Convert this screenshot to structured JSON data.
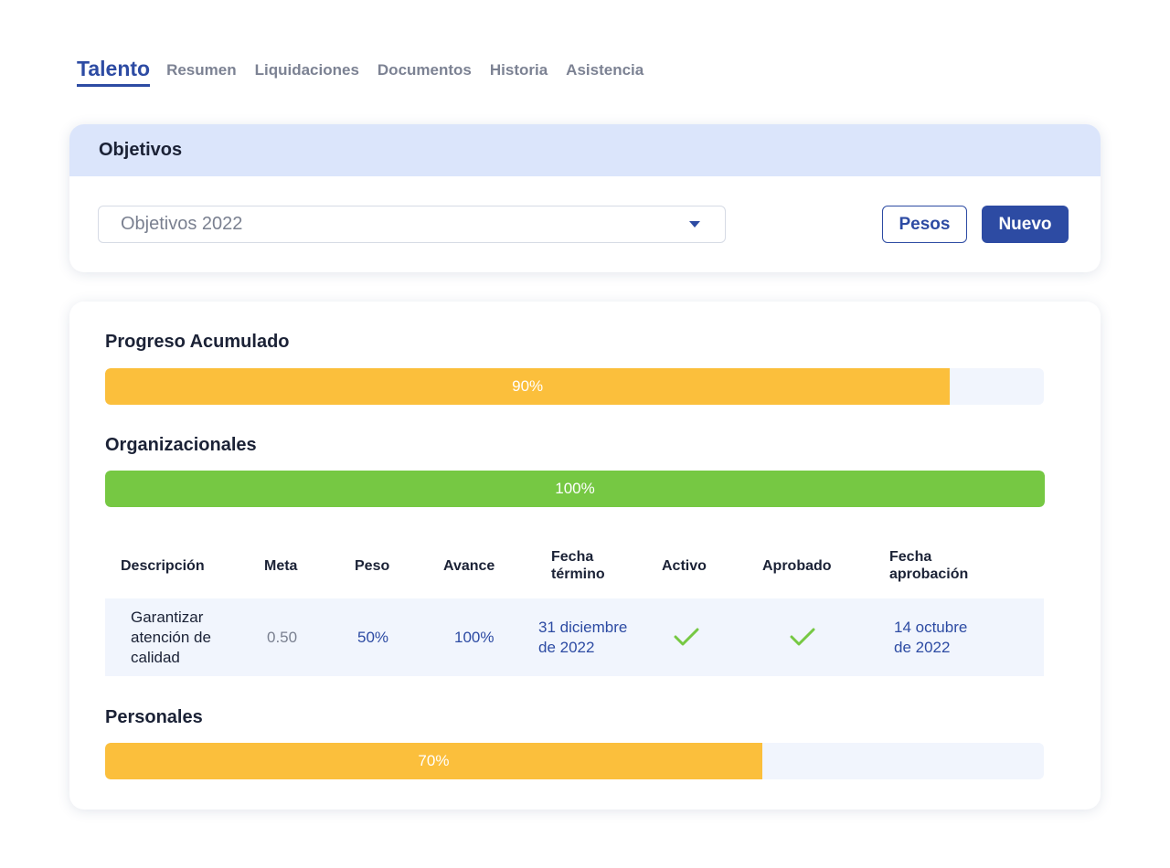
{
  "tabs": [
    {
      "label": "Talento",
      "active": true
    },
    {
      "label": "Resumen",
      "active": false
    },
    {
      "label": "Liquidaciones",
      "active": false
    },
    {
      "label": "Documentos",
      "active": false
    },
    {
      "label": "Historia",
      "active": false
    },
    {
      "label": "Asistencia",
      "active": false
    }
  ],
  "objetivos": {
    "title": "Objetivos",
    "select_value": "Objetivos 2022",
    "pesos_label": "Pesos",
    "nuevo_label": "Nuevo"
  },
  "progreso": {
    "acumulado": {
      "title": "Progreso Acumulado",
      "percent": 90,
      "label": "90%",
      "color": "#fbbf3c"
    },
    "organizacionales": {
      "title": "Organizacionales",
      "percent": 100,
      "label": "100%",
      "color": "#76c843"
    },
    "personales": {
      "title": "Personales",
      "percent": 70,
      "label": "70%",
      "color": "#fbbf3c"
    }
  },
  "table": {
    "headers": {
      "descripcion": "Descripción",
      "meta": "Meta",
      "peso": "Peso",
      "avance": "Avance",
      "fecha_termino_1": "Fecha",
      "fecha_termino_2": "término",
      "activo": "Activo",
      "aprobado": "Aprobado",
      "fecha_aprobacion_1": "Fecha",
      "fecha_aprobacion_2": "aprobación"
    },
    "rows": [
      {
        "descripcion_1": "Garantizar",
        "descripcion_2": "atención de",
        "descripcion_3": "calidad",
        "meta": "0.50",
        "peso": "50%",
        "avance": "100%",
        "fecha_termino_1": "31 diciembre",
        "fecha_termino_2": "de 2022",
        "activo": true,
        "aprobado": true,
        "fecha_aprobacion_1": "14 octubre",
        "fecha_aprobacion_2": "de 2022"
      }
    ]
  },
  "colors": {
    "accent": "#2d4ba3",
    "header_bg": "#dbe5fb",
    "check": "#76c843"
  }
}
